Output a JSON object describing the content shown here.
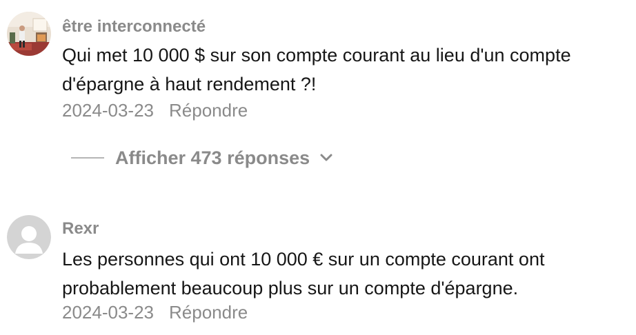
{
  "comments": [
    {
      "username": "être interconnecté",
      "avatar_icon": "user-photo-avatar-icon",
      "text": "Qui met 10 000 $ sur son compte courant au lieu d'un compte d'épargne à haut rendement ?!",
      "date": "2024-03-23",
      "reply_label": "Répondre",
      "view_replies_label": "Afficher 473 réponses"
    },
    {
      "username": "Rexr",
      "avatar_icon": "default-user-avatar-icon",
      "text": "Les personnes qui ont 10 000 € sur un compte courant ont probablement beaucoup plus sur un compte d'épargne.",
      "date": "2024-03-23",
      "reply_label": "Répondre"
    }
  ],
  "colors": {
    "text_primary": "#161616",
    "text_secondary": "#8a8a8a",
    "default_avatar_bg": "#d4d4d4"
  }
}
